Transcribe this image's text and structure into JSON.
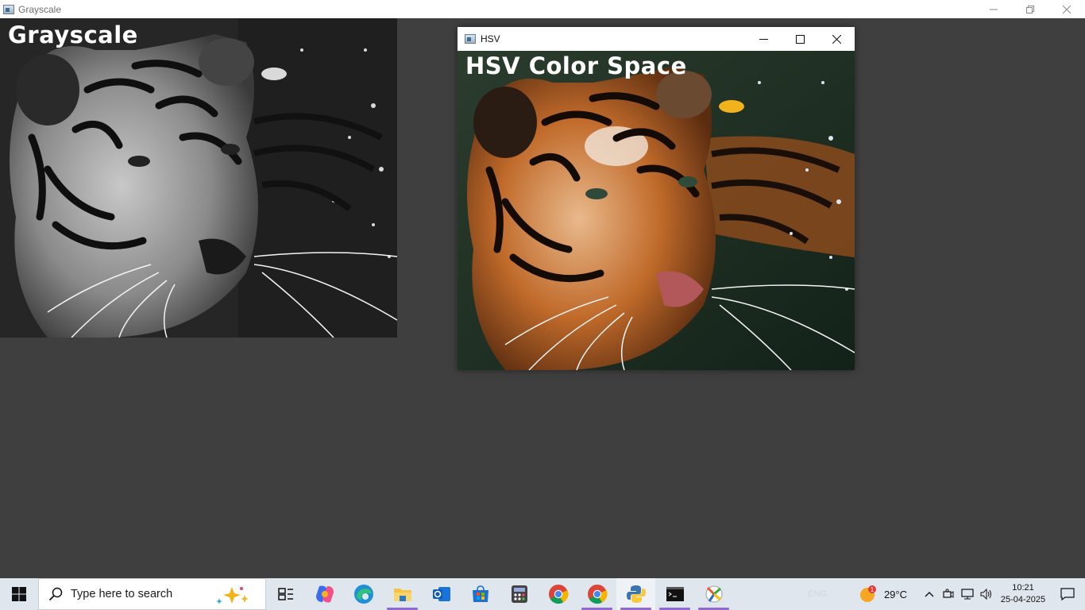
{
  "main_window": {
    "title": "Grayscale",
    "icon": "opencv-window-icon",
    "controls": [
      "minimize-icon",
      "restore-icon",
      "close-icon"
    ]
  },
  "grayscale_view": {
    "overlay_text": "Grayscale"
  },
  "hsv_window": {
    "title": "HSV",
    "icon": "opencv-window-icon",
    "overlay_text": "HSV Color Space",
    "controls": [
      "minimize-icon",
      "maximize-icon",
      "close-icon"
    ]
  },
  "taskbar": {
    "search_placeholder": "Type here to search",
    "apps": [
      "task-view",
      "copilot",
      "edge",
      "file-explorer",
      "outlook",
      "microsoft-store",
      "calculator",
      "chrome",
      "chrome-profile",
      "python",
      "terminal",
      "paint-app"
    ],
    "weather": {
      "temp": "29°C",
      "badge": "1"
    },
    "tray_lang": "ENG",
    "clock": {
      "time": "10:21",
      "date": "25-04-2025"
    }
  },
  "colors": {
    "desktop_bg": "#3f3f3f",
    "taskbar_bg": "#dfe6ee",
    "running_indicator": "#8f6bd6"
  }
}
